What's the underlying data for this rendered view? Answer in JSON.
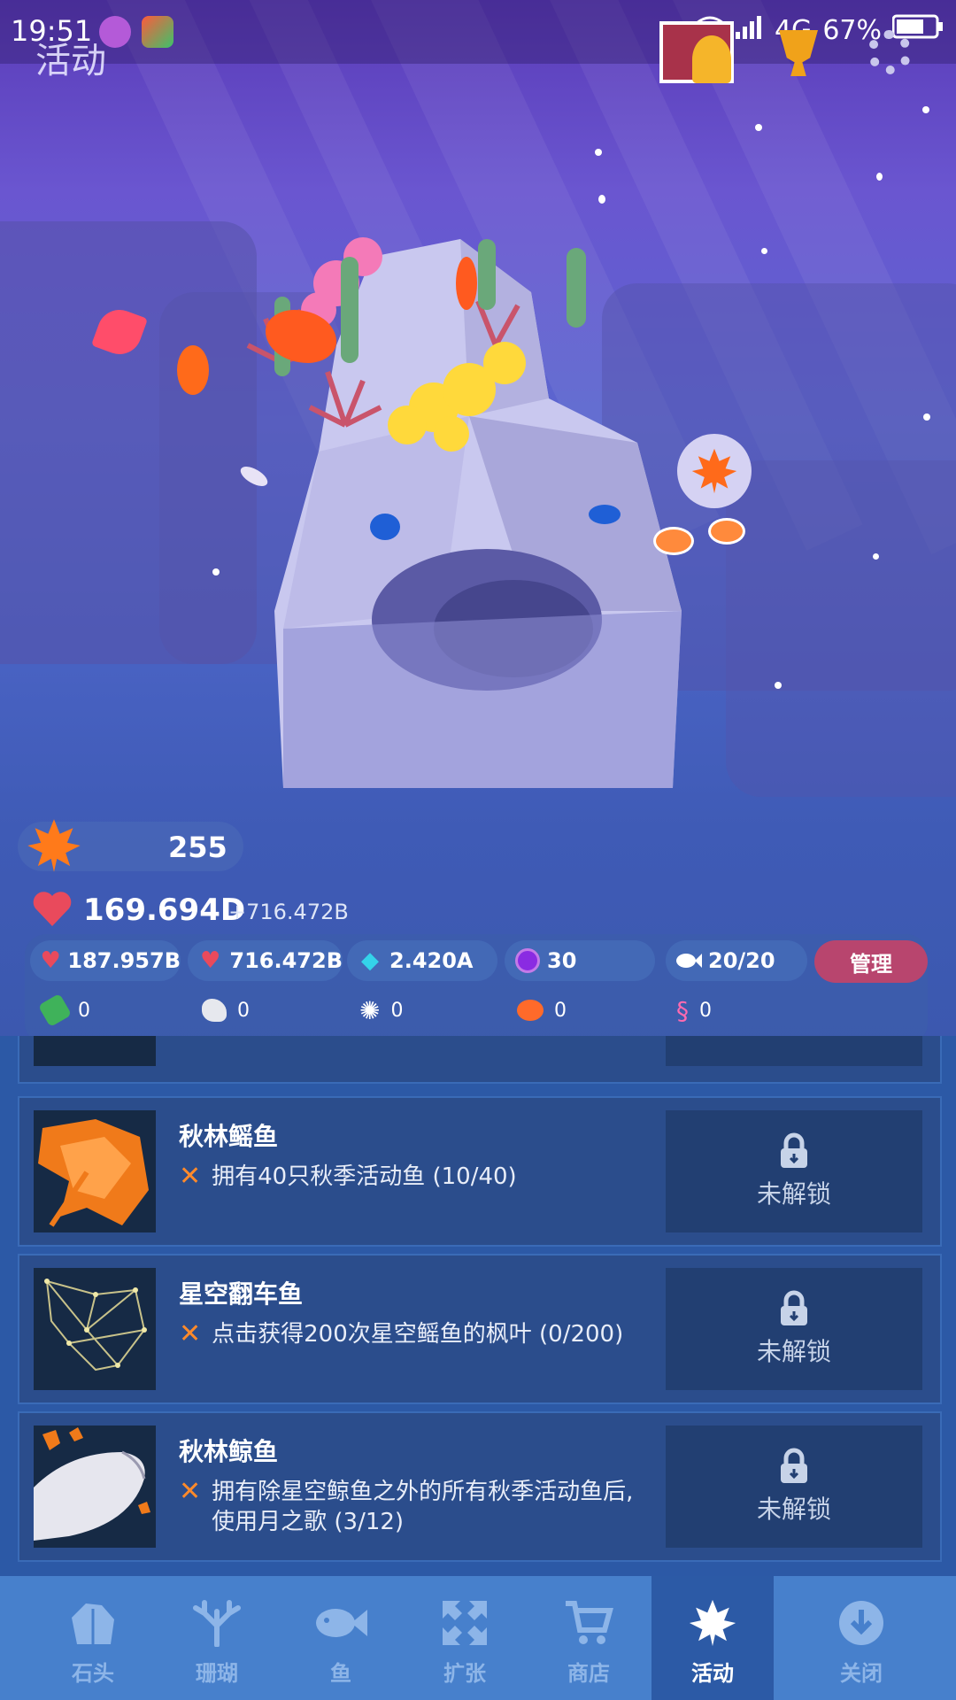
{
  "status_bar": {
    "time": "19:51",
    "network": "4G",
    "battery": "67%"
  },
  "screen_title": "活动",
  "maple_currency": {
    "value": "255",
    "icon": "maple-leaf-icon"
  },
  "vitality": {
    "total": "169.694D",
    "rate": "+716.472B"
  },
  "stats": {
    "tap_value": "187.957B",
    "per_sec": "716.472B",
    "gems": "2.420A",
    "pearls": "30",
    "fish_count": "20/20",
    "manage_label": "管理"
  },
  "items": {
    "seaweed": "0",
    "shell": "0",
    "urchin": "0",
    "crab": "0",
    "seahorse": "0"
  },
  "cards": [
    {
      "name": "秋林鳐鱼",
      "condition_line1": "拥有40只秋季活动鱼 (10/40)",
      "condition_line2": "",
      "lock_label": "未解锁"
    },
    {
      "name": "星空翻车鱼",
      "condition_line1": "点击获得200次星空鳐鱼的枫叶 (0/200)",
      "condition_line2": "",
      "lock_label": "未解锁"
    },
    {
      "name": "秋林鲸鱼",
      "condition_line1": "拥有除星空鲸鱼之外的所有秋季活动鱼后,",
      "condition_line2": "使用月之歌 (3/12)",
      "lock_label": "未解锁"
    }
  ],
  "tabs": [
    {
      "label": "石头",
      "icon": "rock-icon"
    },
    {
      "label": "珊瑚",
      "icon": "coral-icon"
    },
    {
      "label": "鱼",
      "icon": "fish-icon"
    },
    {
      "label": "扩张",
      "icon": "expand-icon"
    },
    {
      "label": "商店",
      "icon": "cart-icon"
    },
    {
      "label": "活动",
      "icon": "maple-leaf-icon"
    },
    {
      "label": "关闭",
      "icon": "close-down-icon"
    }
  ],
  "colors": {
    "accent_maple": "#ff7a1a",
    "manage_button": "#b8456e",
    "cross_mark": "#ff8a2a"
  }
}
